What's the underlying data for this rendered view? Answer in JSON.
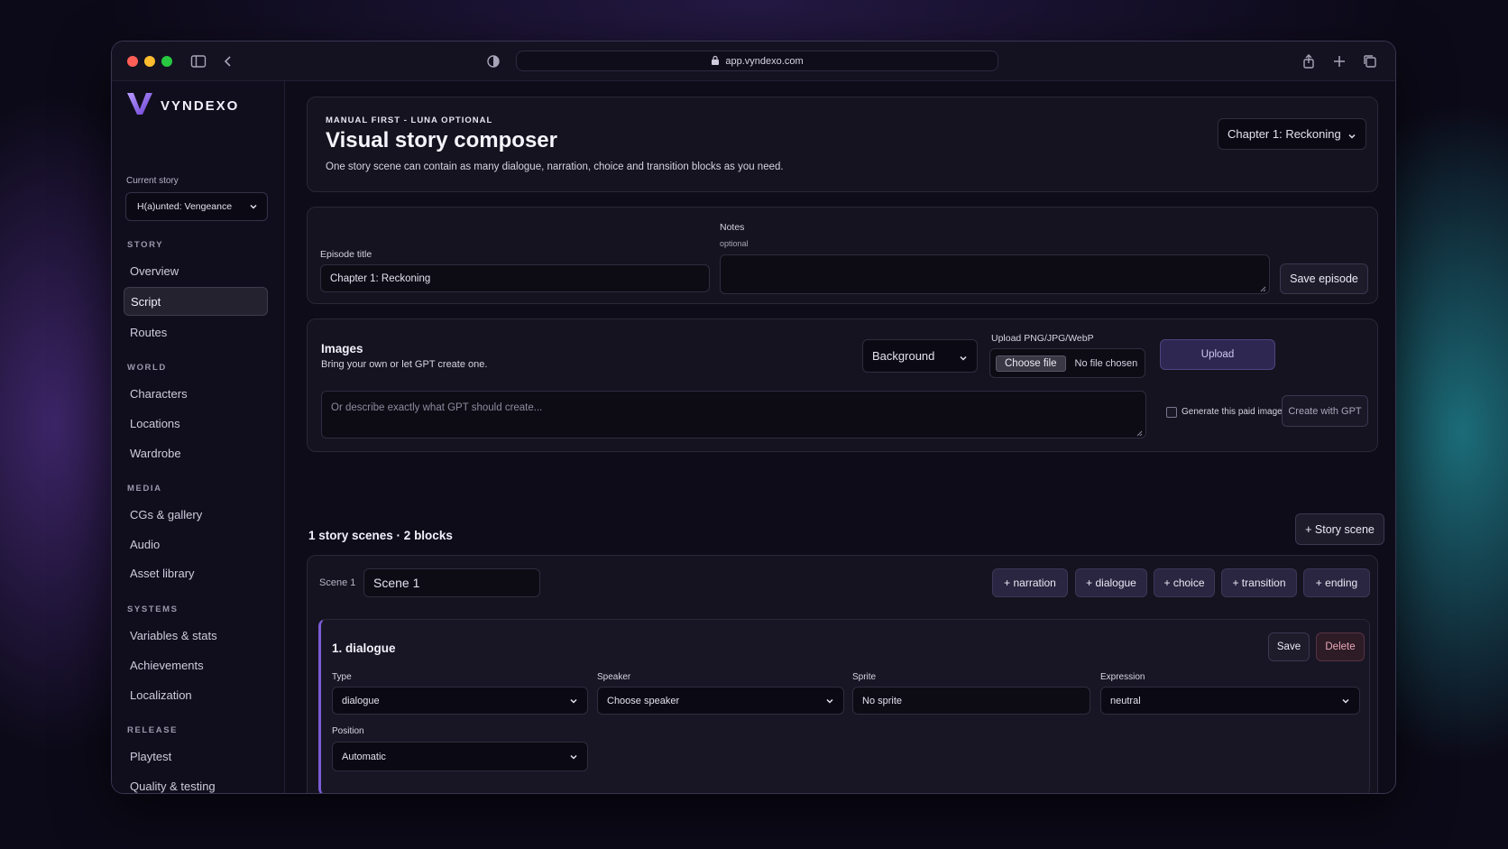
{
  "browser": {
    "url": "app.vyndexo.com"
  },
  "sidebar": {
    "logo_text": "VYNDEXO",
    "current_story_label": "Current story",
    "current_story_value": "H(a)unted: Vengeance",
    "sections": [
      {
        "title": "STORY",
        "items": [
          "Overview",
          "Script",
          "Routes"
        ]
      },
      {
        "title": "WORLD",
        "items": [
          "Characters",
          "Locations",
          "Wardrobe"
        ]
      },
      {
        "title": "MEDIA",
        "items": [
          "CGs & gallery",
          "Audio",
          "Asset library"
        ]
      },
      {
        "title": "SYSTEMS",
        "items": [
          "Variables & stats",
          "Achievements",
          "Localization"
        ]
      },
      {
        "title": "RELEASE",
        "items": [
          "Playtest",
          "Quality & testing"
        ]
      }
    ],
    "active_item": "Script"
  },
  "header": {
    "eyebrow": "MANUAL FIRST - LUNA OPTIONAL",
    "title": "Visual story composer",
    "subtitle": "One story scene can contain as many dialogue, narration, choice and transition blocks as you need.",
    "chapter_select": "Chapter 1: Reckoning"
  },
  "episode": {
    "title_label": "Episode title",
    "title_value": "Chapter 1: Reckoning",
    "notes_label": "Notes",
    "notes_hint": "optional",
    "notes_value": "",
    "save_label": "Save episode"
  },
  "images": {
    "title": "Images",
    "subtitle": "Bring your own or let GPT create one.",
    "type_select": "Background",
    "upload_label": "Upload PNG/JPG/WebP",
    "choose_file": "Choose file",
    "no_file": "No file chosen",
    "upload_button": "Upload",
    "prompt_placeholder": "Or describe exactly what GPT should create...",
    "paid_checkbox_label": "Generate this paid image",
    "create_button": "Create with GPT"
  },
  "scenes": {
    "summary": "1 story scenes · 2 blocks",
    "add_scene": "+ Story scene",
    "scene_label": "Scene 1",
    "scene_name": "Scene 1",
    "add_buttons": [
      "+ narration",
      "+ dialogue",
      "+ choice",
      "+ transition",
      "+ ending"
    ]
  },
  "block": {
    "title": "1. dialogue",
    "save": "Save",
    "delete": "Delete",
    "type_label": "Type",
    "type_value": "dialogue",
    "speaker_label": "Speaker",
    "speaker_value": "Choose speaker",
    "sprite_label": "Sprite",
    "sprite_value": "No sprite",
    "expression_label": "Expression",
    "expression_value": "neutral",
    "position_label": "Position",
    "position_value": "Automatic"
  },
  "colors": {
    "accent": "#7b5cd6",
    "background": "#0e0c19",
    "panel": "#15131f"
  }
}
